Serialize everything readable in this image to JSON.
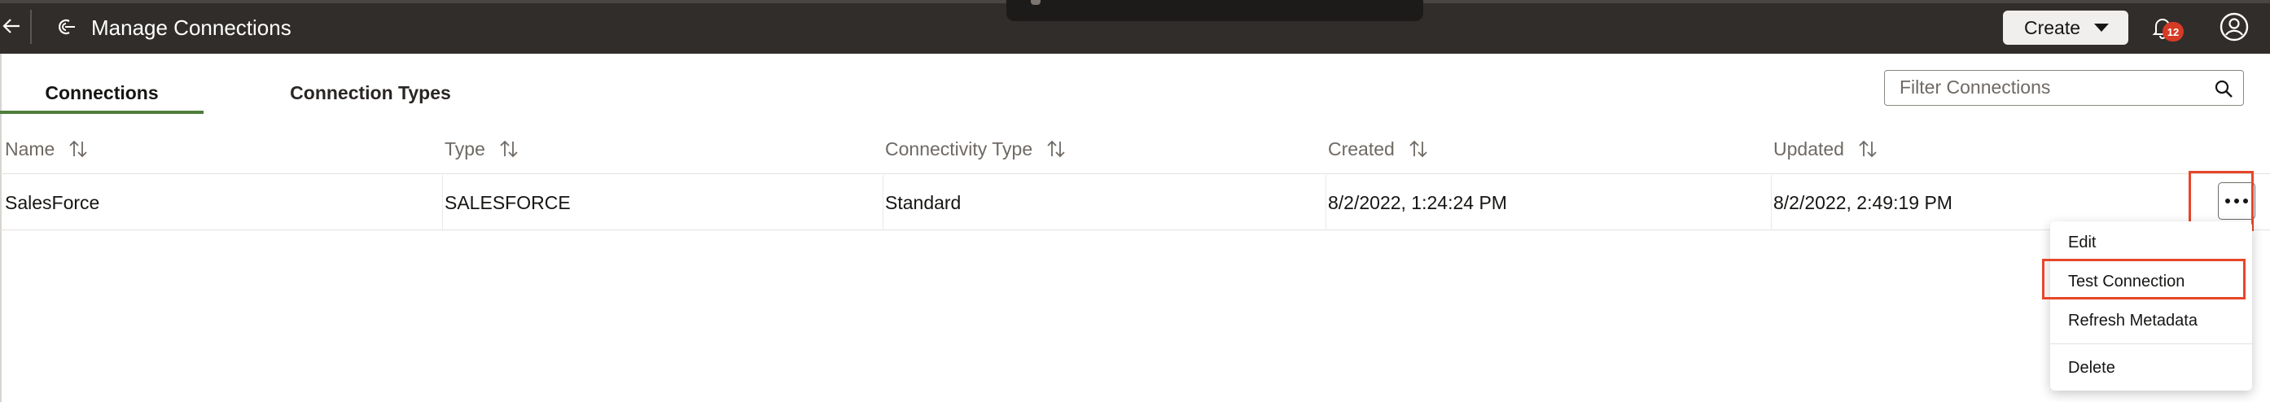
{
  "header": {
    "title": "Manage Connections",
    "create_label": "Create",
    "notification_count": "12",
    "icons": [
      "back-arrow-icon",
      "connections-app-icon",
      "chevron-down-icon",
      "bell-icon",
      "user-avatar-icon"
    ]
  },
  "tabs": [
    {
      "label": "Connections",
      "selected": true
    },
    {
      "label": "Connection Types",
      "selected": false
    }
  ],
  "filter": {
    "placeholder": "Filter Connections",
    "value": ""
  },
  "table": {
    "columns": [
      "Name",
      "Type",
      "Connectivity Type",
      "Created",
      "Updated"
    ],
    "rows": [
      {
        "name": "SalesForce",
        "type": "SALESFORCE",
        "connectivity": "Standard",
        "created": "8/2/2022, 1:24:24 PM",
        "updated": "8/2/2022, 2:49:19 PM"
      }
    ]
  },
  "menu": {
    "items": [
      "Edit",
      "Test Connection",
      "Refresh Metadata",
      "Delete"
    ],
    "highlighted": "Test Connection"
  },
  "colors": {
    "header_bg": "#312d2a",
    "tab_underline": "#4f7d3b",
    "badge": "#d63b25",
    "highlight_box": "#e8462a"
  }
}
